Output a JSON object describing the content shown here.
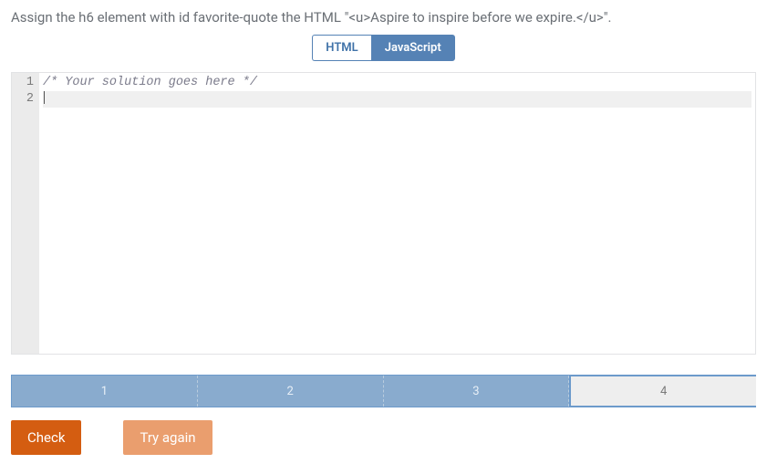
{
  "prompt": "Assign the h6 element with id favorite-quote the HTML \"<u>Aspire to inspire before we expire.</u>\".",
  "tabs": {
    "html": "HTML",
    "javascript": "JavaScript",
    "active": "javascript"
  },
  "editor": {
    "lines": [
      {
        "n": "1",
        "text": "/* Your solution goes here */"
      },
      {
        "n": "2",
        "text": ""
      }
    ]
  },
  "steps": {
    "items": [
      {
        "label": "1",
        "state": "done"
      },
      {
        "label": "2",
        "state": "done"
      },
      {
        "label": "3",
        "state": "done"
      },
      {
        "label": "4",
        "state": "current"
      }
    ]
  },
  "buttons": {
    "check": "Check",
    "try_again": "Try again"
  }
}
